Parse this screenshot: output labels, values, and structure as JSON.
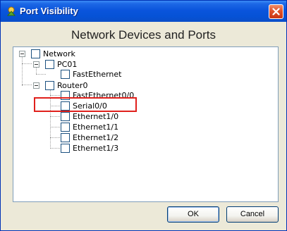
{
  "window": {
    "title": "Port Visibility"
  },
  "heading": "Network Devices and Ports",
  "tree": {
    "root": {
      "label": "Network",
      "checked": false,
      "expanded": true
    },
    "pc": {
      "label": "PC01",
      "checked": false,
      "expanded": true
    },
    "pc_ports": [
      {
        "label": "FastEthernet",
        "checked": false
      }
    ],
    "router": {
      "label": "Router0",
      "checked": false,
      "expanded": true
    },
    "router_ports": [
      {
        "label": "FastEthernet0/0",
        "checked": false
      },
      {
        "label": "Serial0/0",
        "checked": false
      },
      {
        "label": "Ethernet1/0",
        "checked": false
      },
      {
        "label": "Ethernet1/1",
        "checked": false
      },
      {
        "label": "Ethernet1/2",
        "checked": false
      },
      {
        "label": "Ethernet1/3",
        "checked": false
      }
    ]
  },
  "buttons": {
    "ok": "OK",
    "cancel": "Cancel"
  },
  "colors": {
    "titlebar": "#0a55dc",
    "dialog_bg": "#ece9d8",
    "highlight": "#e0201c"
  }
}
